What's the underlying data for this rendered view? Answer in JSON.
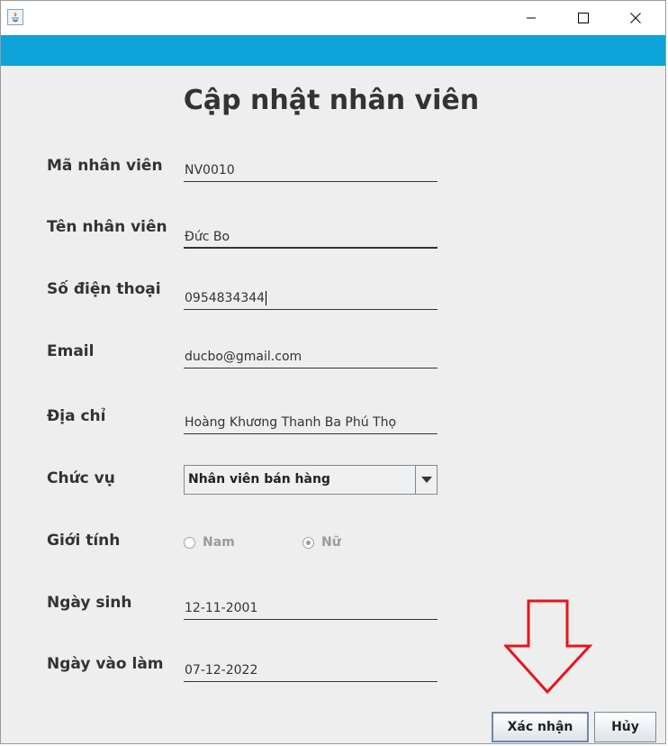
{
  "window": {
    "icon": "java-icon",
    "controls": [
      "minimize-icon",
      "maximize-icon",
      "close-icon"
    ]
  },
  "form": {
    "title": "Cập nhật nhân viên",
    "fields": [
      {
        "label": "Mã nhân viên",
        "value": "NV0010"
      },
      {
        "label": "Tên nhân viên",
        "value": "Đức Bo"
      },
      {
        "label": "Số điện thoại",
        "value": "0954834344"
      },
      {
        "label": "Email",
        "value": "ducbo@gmail.com"
      },
      {
        "label": "Địa chỉ",
        "value": "Hoàng Khương Thanh Ba Phú Thọ"
      }
    ],
    "position": {
      "label": "Chức vụ",
      "selected": "Nhân viên bán hàng"
    },
    "gender": {
      "label": "Giới tính",
      "options": [
        "Nam",
        "Nữ"
      ],
      "selected": "Nữ"
    },
    "birth_date": {
      "label": "Ngày sinh",
      "value": "12-11-2001"
    },
    "start_date": {
      "label": "Ngày vào làm",
      "value": "07-12-2022"
    }
  },
  "buttons": {
    "confirm": "Xác nhận",
    "cancel": "Hủy"
  },
  "colors": {
    "banner": "#0ca3d9",
    "annotation_arrow": "#e8141c",
    "text": "#333333"
  }
}
